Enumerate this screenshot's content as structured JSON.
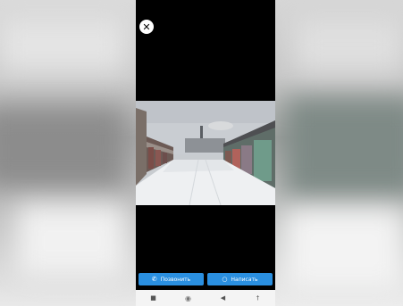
{
  "viewer": {
    "close_icon": "close-icon",
    "photo_description_icon": "photo"
  },
  "actions": {
    "call_label": "Позвонить",
    "call_icon": "phone-icon",
    "message_label": "Написать",
    "message_icon": "chat-bubble-icon",
    "accent_color": "#2a8fe0"
  },
  "navbar": {
    "items": [
      {
        "icon": "menu-square-icon",
        "glyph": "■"
      },
      {
        "icon": "home-circle-icon",
        "glyph": "◉"
      },
      {
        "icon": "back-triangle-icon",
        "glyph": "◀"
      },
      {
        "icon": "accessibility-icon",
        "glyph": "†"
      }
    ]
  }
}
